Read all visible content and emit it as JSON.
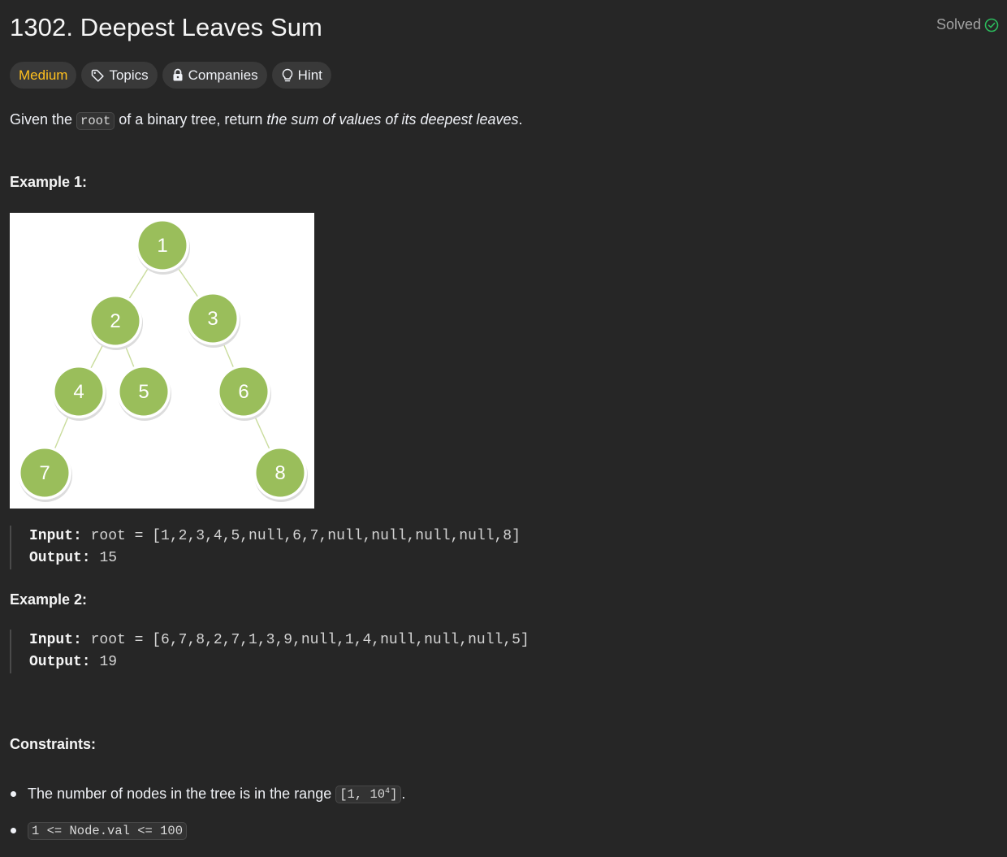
{
  "header": {
    "title": "1302. Deepest Leaves Sum",
    "solved_label": "Solved",
    "solved_color": "#2cbb5d"
  },
  "tags": {
    "difficulty": "Medium",
    "difficulty_color": "#ffc01e",
    "topics": "Topics",
    "companies": "Companies",
    "hint": "Hint"
  },
  "description": {
    "prefix": "Given the ",
    "code": "root",
    "middle": " of a binary tree, return ",
    "emphasis": "the sum of values of its deepest leaves",
    "suffix": "."
  },
  "example1": {
    "title": "Example 1:",
    "tree_nodes": [
      "1",
      "2",
      "3",
      "4",
      "5",
      "6",
      "7",
      "8"
    ],
    "node_color": "#9abe5b",
    "input_label": "Input:",
    "input_value": "root = [1,2,3,4,5,null,6,7,null,null,null,null,8]",
    "output_label": "Output:",
    "output_value": "15"
  },
  "example2": {
    "title": "Example 2:",
    "input_label": "Input:",
    "input_value": "root = [6,7,8,2,7,1,3,9,null,1,4,null,null,null,5]",
    "output_label": "Output:",
    "output_value": "19"
  },
  "constraints": {
    "title": "Constraints:",
    "item1_text": "The number of nodes in the tree is in the range",
    "item1_code_base": "[1, 10",
    "item1_code_sup": "4",
    "item1_code_end": "]",
    "item1_after": ".",
    "item2_code": "1 <= Node.val <= 100"
  }
}
